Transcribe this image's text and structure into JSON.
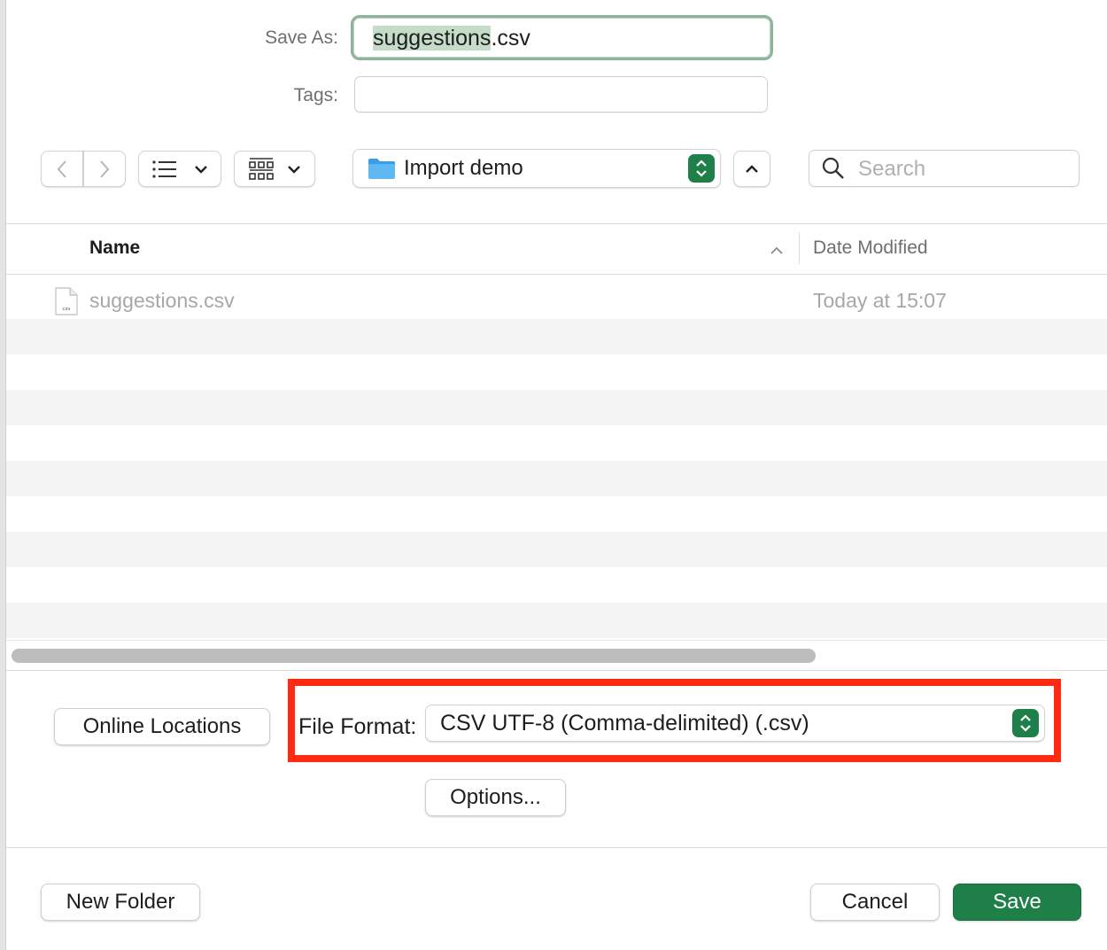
{
  "form": {
    "save_as_label": "Save As:",
    "filename_selected": "suggestions",
    "filename_ext": ".csv",
    "tags_label": "Tags:",
    "tags_value": ""
  },
  "toolbar": {
    "location": "Import demo",
    "search_placeholder": "Search"
  },
  "browser": {
    "columns": {
      "name": "Name",
      "date_modified": "Date Modified"
    },
    "files": [
      {
        "icon_label": "csv",
        "name": "suggestions.csv",
        "date": "Today at 15:07"
      }
    ]
  },
  "options": {
    "online_locations": "Online Locations",
    "file_format_label": "File Format:",
    "file_format_value": "CSV UTF-8 (Comma-delimited) (.csv)",
    "options_button": "Options..."
  },
  "footer": {
    "new_folder": "New Folder",
    "cancel": "Cancel",
    "save": "Save"
  },
  "colors": {
    "accent": "#1f7f49",
    "selection": "#c5dcc9",
    "focus_ring": "#8fb49c",
    "highlight_box": "#ff2a12"
  }
}
